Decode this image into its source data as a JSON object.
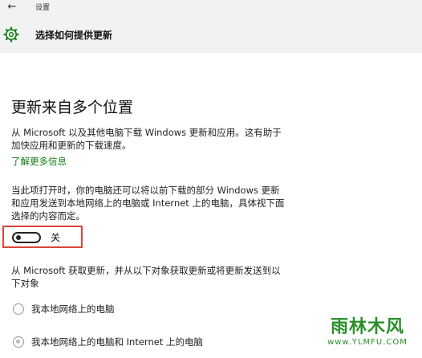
{
  "window": {
    "back_icon": "back-arrow-icon",
    "title": "设置"
  },
  "header": {
    "icon": "gear-icon",
    "title": "选择如何提供更新"
  },
  "section": {
    "title": "更新来自多个位置",
    "intro_line1": "从 Microsoft 以及其他电脑下载 Windows 更新和应用。这有助于",
    "intro_line2": "加快应用和更新的下载速度。",
    "learn_more": "了解更多信息",
    "desc_line1": "当此项打开时，你的电脑还可以将以前下载的部分 Windows 更新",
    "desc_line2": "和应用发送到本地网络上的电脑或 Internet 上的电脑，具体视下面",
    "desc_line3": "选择的内容而定。"
  },
  "toggle": {
    "state": "off",
    "label": "关",
    "highlight_color": "#d9443a"
  },
  "source": {
    "line1": "从 Microsoft 获取更新，并从以下对象获取更新或将更新发送到以",
    "line2": "下对象",
    "options": [
      {
        "label": "我本地网络上的电脑",
        "selected": false
      },
      {
        "label": "我本地网络上的电脑和 Internet 上的电脑",
        "selected": true
      }
    ]
  },
  "watermark": {
    "text": "雨林木风",
    "url": "www.YLMFU.COM"
  },
  "colors": {
    "link": "#107c10",
    "header_bg": "#f2f2f2"
  }
}
